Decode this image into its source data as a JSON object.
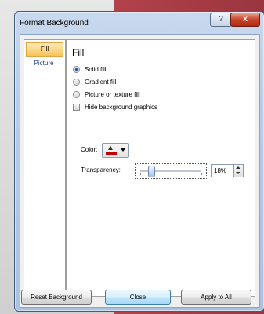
{
  "window": {
    "title": "Format Background",
    "help_label": "?",
    "close_label": "x"
  },
  "nav": {
    "items": [
      {
        "label": "Fill"
      },
      {
        "label": "Picture"
      }
    ]
  },
  "fill": {
    "heading": "Fill",
    "options": [
      {
        "label": "Solid fill",
        "selected": true
      },
      {
        "label": "Gradient fill",
        "selected": false
      },
      {
        "label": "Picture or texture fill",
        "selected": false
      }
    ],
    "hide_graphics": {
      "label": "Hide background graphics",
      "checked": false
    },
    "color_label": "Color:",
    "color_value": "#C00000",
    "transparency_label": "Transparency:",
    "transparency_value": "18%",
    "transparency_fraction": 0.18
  },
  "footer": {
    "reset_label": "Reset Background",
    "close_label": "Close",
    "apply_label": "Apply to All"
  }
}
